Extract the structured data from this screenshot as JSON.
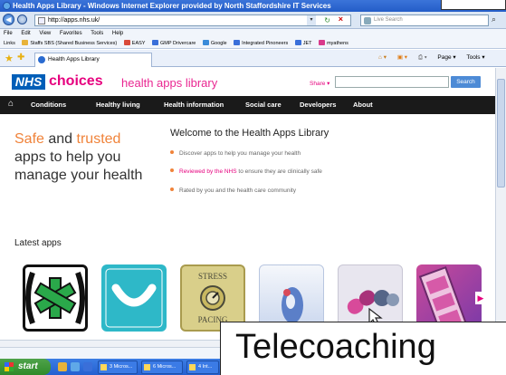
{
  "window": {
    "title": "Health Apps Library - Windows Internet Explorer provided by North Staffordshire IT Services"
  },
  "address_bar": {
    "url": "http://apps.nhs.uk/",
    "live_search_placeholder": "Live Search"
  },
  "menu": [
    "File",
    "Edit",
    "View",
    "Favorites",
    "Tools",
    "Help"
  ],
  "links_bar": {
    "label": "Links",
    "items": [
      {
        "label": "Staffs SBS (Shared Business Services)",
        "color": "#e8b33a"
      },
      {
        "label": "EASY",
        "color": "#d94a3a"
      },
      {
        "label": "GMP Drivercare",
        "color": "#3a6fd9"
      },
      {
        "label": "Google",
        "color": "#3a8bd9"
      },
      {
        "label": "Integrated Pinoneers",
        "color": "#3a6fd9"
      },
      {
        "label": "JET",
        "color": "#3a6fd9"
      },
      {
        "label": "myathens",
        "color": "#d93a8b"
      }
    ]
  },
  "tab": {
    "label": "Health Apps Library"
  },
  "tab_tools": [
    "Page ▾",
    "Tools ▾"
  ],
  "site": {
    "logo_nhs": "NHS",
    "logo_choices": "choices",
    "logo_sub": "health apps library",
    "share_label": "Share ▾",
    "search_button": "Search",
    "brand_color": "#e6007e",
    "nhs_blue": "#005eb8",
    "accent_orange": "#f0833a"
  },
  "nav": {
    "items": [
      "Conditions",
      "Healthy living",
      "Health information",
      "Social care",
      "Developers",
      "About"
    ]
  },
  "hero": {
    "word_safe": "Safe",
    "word_and": " and ",
    "word_trusted": "trusted",
    "line2": "apps to help you",
    "line3": "manage your health"
  },
  "welcome": {
    "title": "Welcome to the Health Apps Library",
    "bullet1": "Discover apps to help you manage your health",
    "bullet2_pink": "Reviewed by the NHS",
    "bullet2_rest": " to ensure they are clinically safe",
    "bullet3": "Rated by you and the health care community"
  },
  "latest": {
    "heading": "Latest apps",
    "apps": [
      {
        "icon": "green-asterisk-app-icon"
      },
      {
        "icon": "teal-smile-app-icon"
      },
      {
        "icon": "stress-pacing-app-icon",
        "line1": "STRESS",
        "line2": "PACING"
      },
      {
        "icon": "pill-hand-app-icon"
      },
      {
        "icon": "capsules-app-icon"
      },
      {
        "icon": "film-strip-app-icon"
      }
    ]
  },
  "taskbar": {
    "start": "start",
    "tasks": [
      "3 Micros...",
      "6 Micros...",
      "4 Int..."
    ]
  },
  "caption": {
    "text": "Telecoaching"
  }
}
